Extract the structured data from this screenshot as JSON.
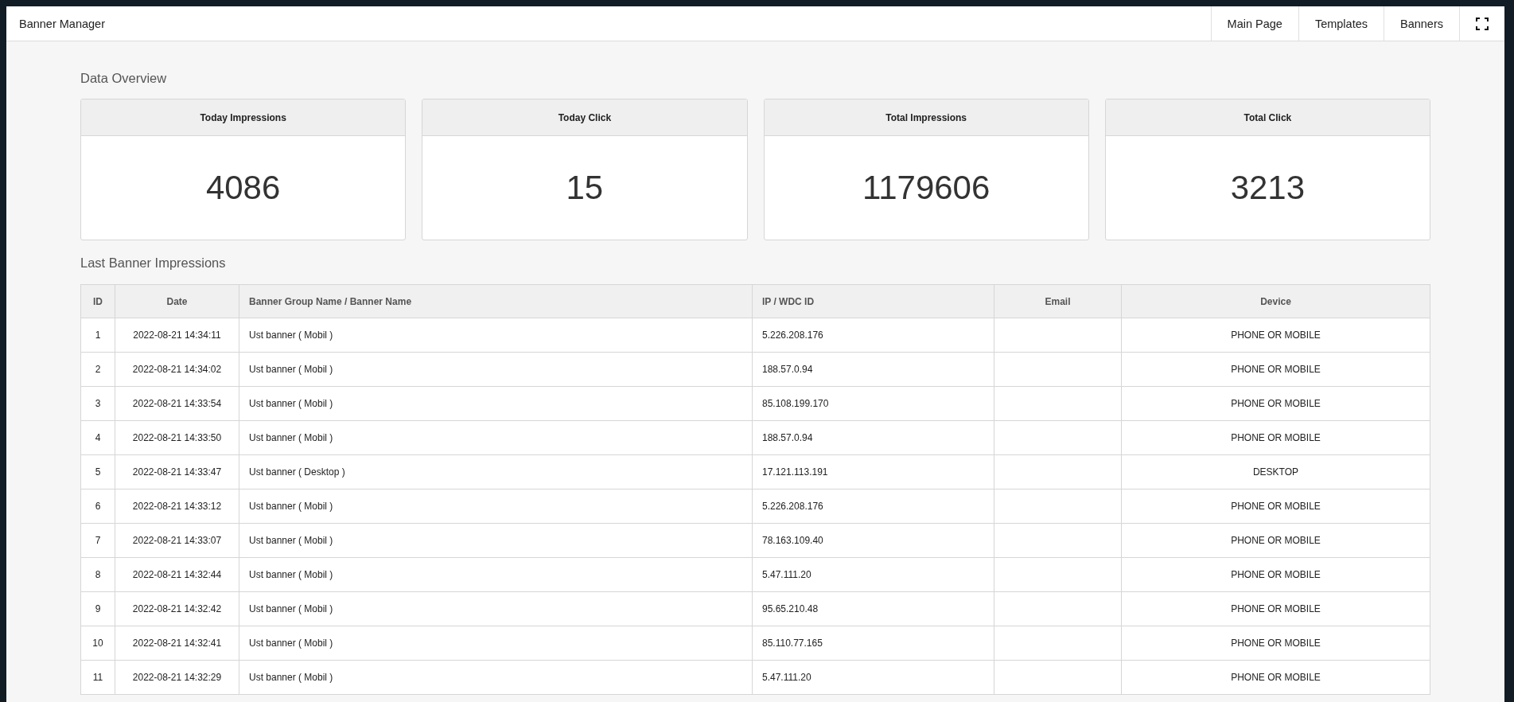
{
  "app": {
    "title": "Banner Manager"
  },
  "nav": {
    "items": [
      {
        "label": "Main Page"
      },
      {
        "label": "Templates"
      },
      {
        "label": "Banners"
      }
    ]
  },
  "overview": {
    "title": "Data Overview",
    "cards": [
      {
        "label": "Today Impressions",
        "value": "4086"
      },
      {
        "label": "Today Click",
        "value": "15"
      },
      {
        "label": "Total Impressions",
        "value": "1179606"
      },
      {
        "label": "Total Click",
        "value": "3213"
      }
    ]
  },
  "impressions": {
    "title": "Last Banner Impressions",
    "columns": [
      "ID",
      "Date",
      "Banner Group Name / Banner Name",
      "IP / WDC ID",
      "Email",
      "Device"
    ],
    "rows": [
      {
        "id": "1",
        "date": "2022-08-21 14:34:11",
        "banner": "Ust banner ( Mobil )",
        "ip": "5.226.208.176",
        "device": "PHONE OR MOBILE"
      },
      {
        "id": "2",
        "date": "2022-08-21 14:34:02",
        "banner": "Ust banner ( Mobil )",
        "ip": "188.57.0.94",
        "device": "PHONE OR MOBILE"
      },
      {
        "id": "3",
        "date": "2022-08-21 14:33:54",
        "banner": "Ust banner ( Mobil )",
        "ip": "85.108.199.170",
        "device": "PHONE OR MOBILE"
      },
      {
        "id": "4",
        "date": "2022-08-21 14:33:50",
        "banner": "Ust banner ( Mobil )",
        "ip": "188.57.0.94",
        "device": "PHONE OR MOBILE"
      },
      {
        "id": "5",
        "date": "2022-08-21 14:33:47",
        "banner": "Ust banner ( Desktop )",
        "ip": "17.121.113.191",
        "device": "DESKTOP"
      },
      {
        "id": "6",
        "date": "2022-08-21 14:33:12",
        "banner": "Ust banner ( Mobil )",
        "ip": "5.226.208.176",
        "device": "PHONE OR MOBILE"
      },
      {
        "id": "7",
        "date": "2022-08-21 14:33:07",
        "banner": "Ust banner ( Mobil )",
        "ip": "78.163.109.40",
        "device": "PHONE OR MOBILE"
      },
      {
        "id": "8",
        "date": "2022-08-21 14:32:44",
        "banner": "Ust banner ( Mobil )",
        "ip": "5.47.111.20",
        "device": "PHONE OR MOBILE"
      },
      {
        "id": "9",
        "date": "2022-08-21 14:32:42",
        "banner": "Ust banner ( Mobil )",
        "ip": "95.65.210.48",
        "device": "PHONE OR MOBILE"
      },
      {
        "id": "10",
        "date": "2022-08-21 14:32:41",
        "banner": "Ust banner ( Mobil )",
        "ip": "85.110.77.165",
        "device": "PHONE OR MOBILE"
      },
      {
        "id": "11",
        "date": "2022-08-21 14:32:29",
        "banner": "Ust banner ( Mobil )",
        "ip": "5.47.111.20",
        "device": "PHONE OR MOBILE"
      }
    ]
  }
}
